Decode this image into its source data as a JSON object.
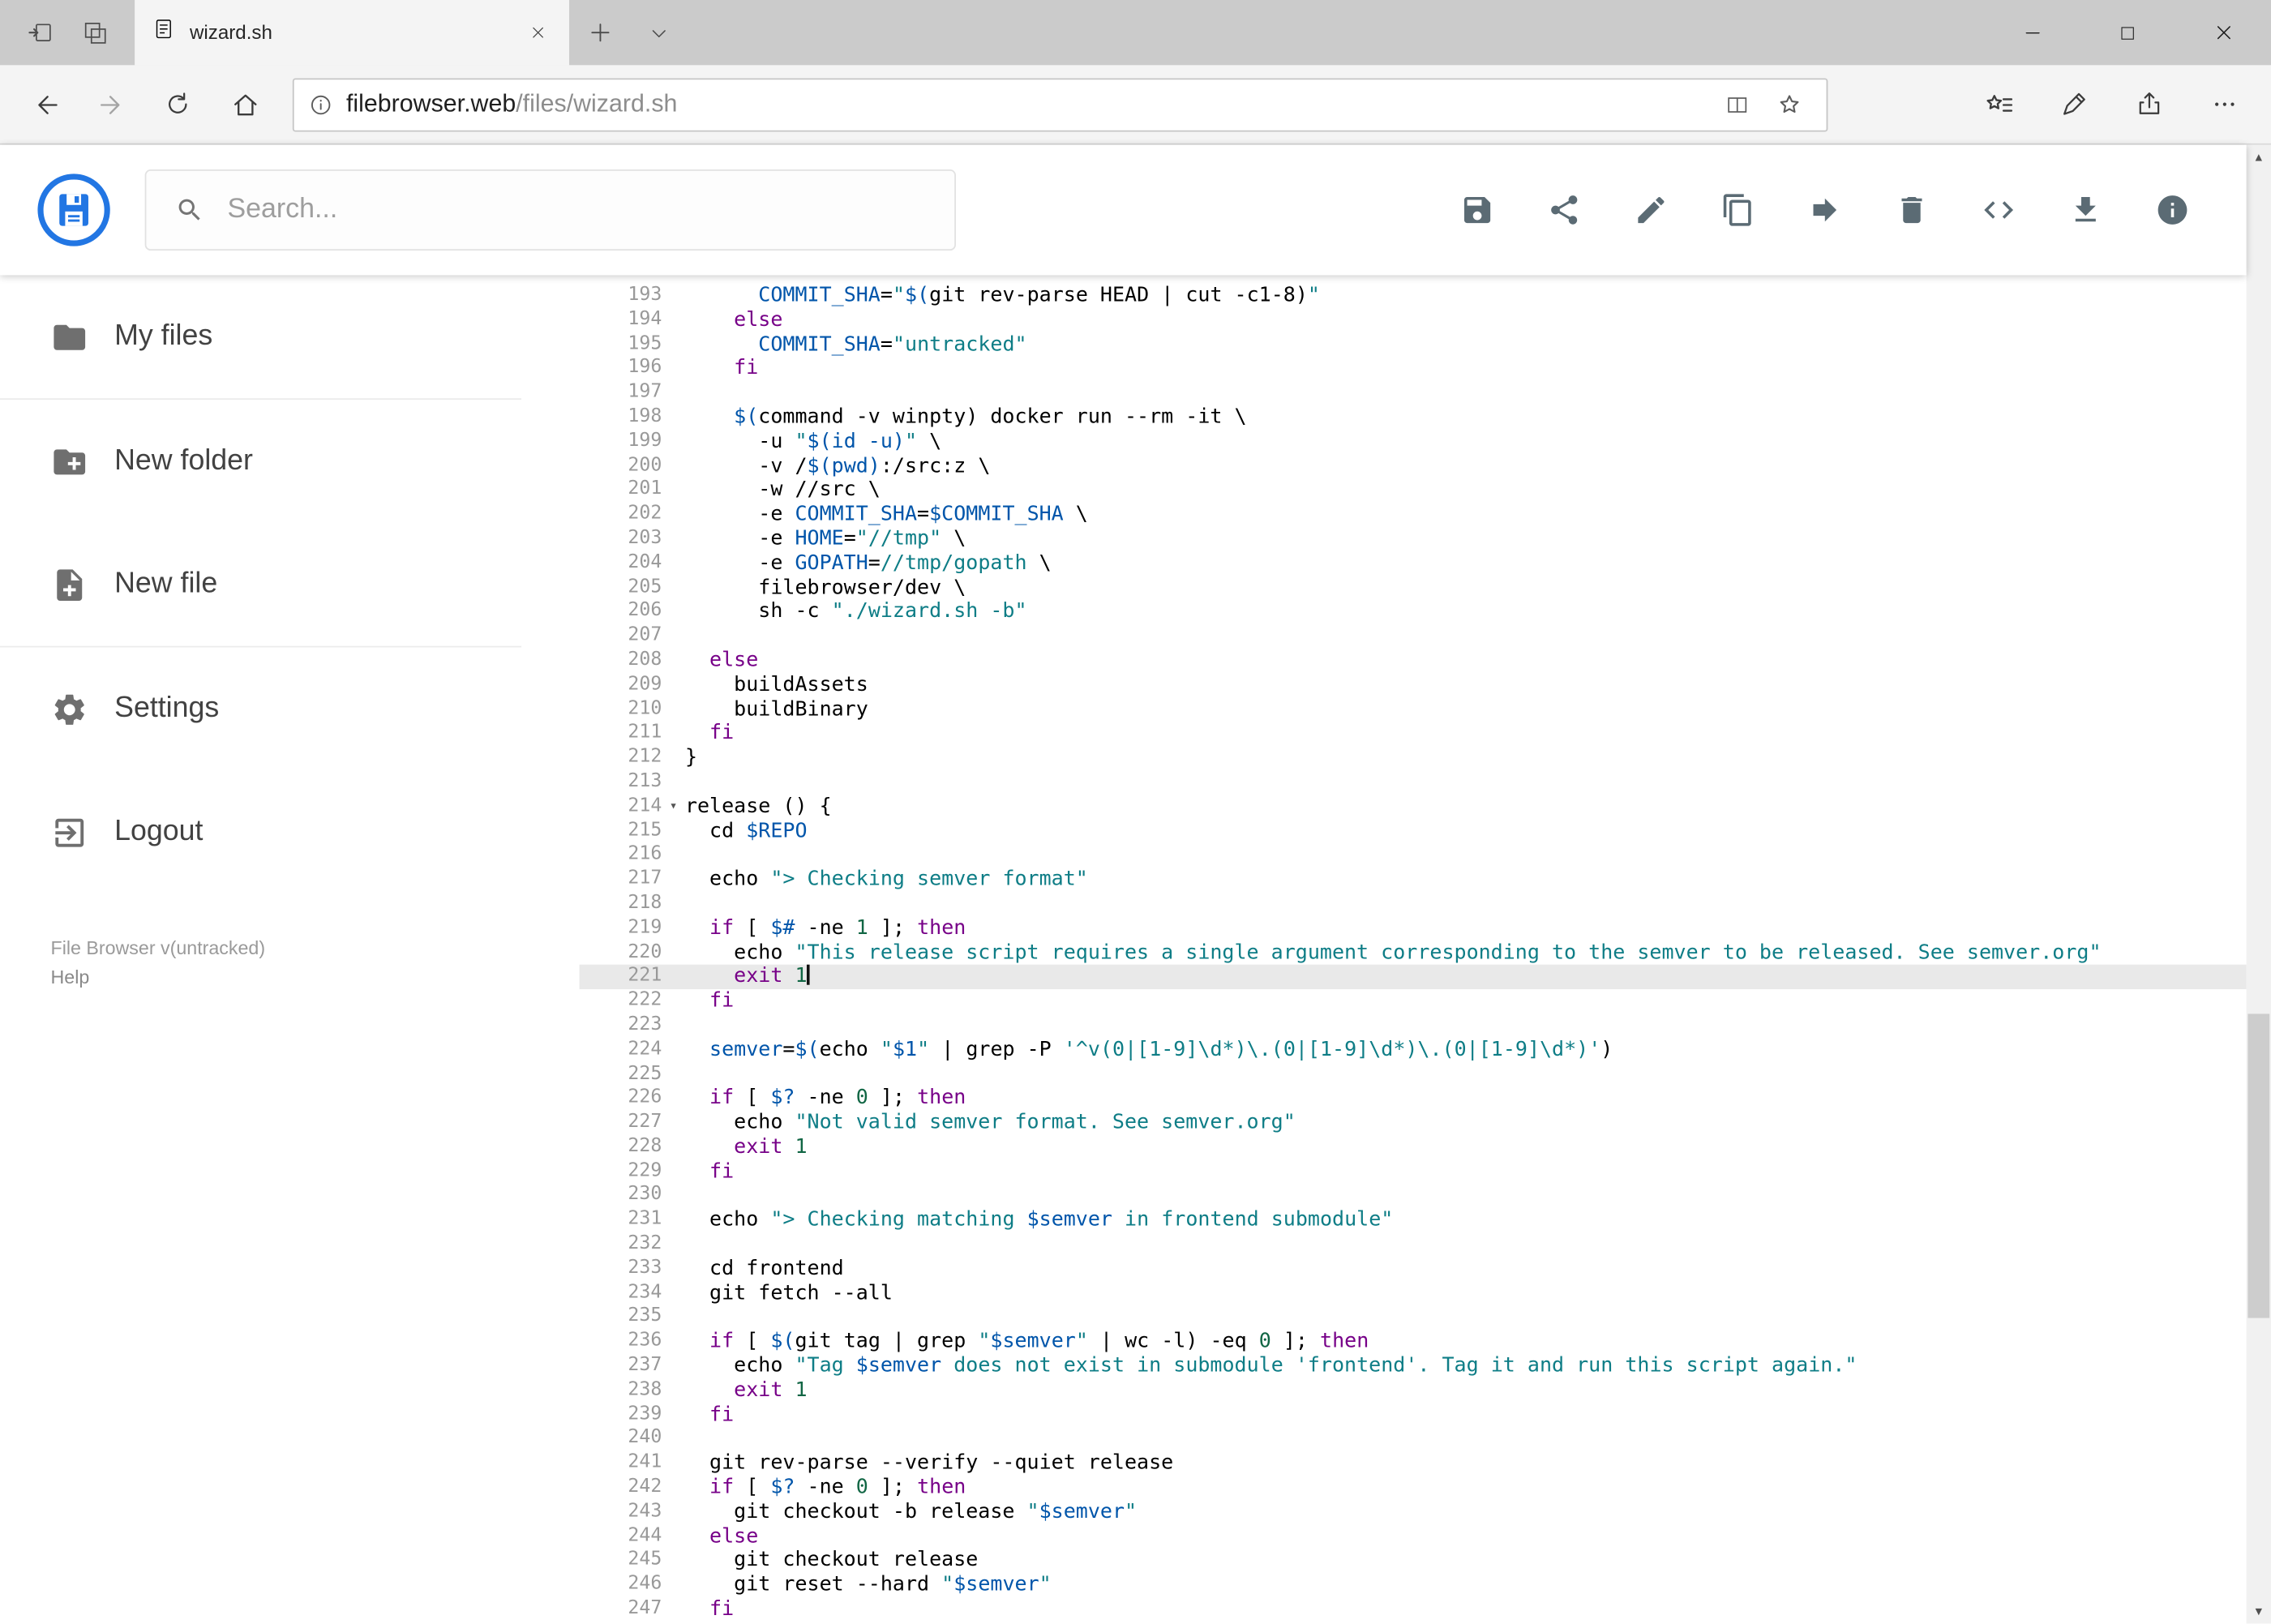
{
  "colors": {
    "accent_blue": "#2276e3",
    "tabbar_bg": "#cbcbcb",
    "chrome_bg": "#f4f4f4",
    "keyword": "#770088",
    "string": "#0e7d86",
    "variable": "#0055aa",
    "number": "#116644",
    "active_line_bg": "#e9e9e9",
    "header_icon": "#5b6b74"
  },
  "browser": {
    "tab_title": "wizard.sh",
    "url_domain": "filebrowser.web",
    "url_path": "/files/wizard.sh",
    "tabbar_icons": [
      "set-tabs-aside",
      "tabs-you-set-aside",
      "new-tab",
      "tab-preview-chevron"
    ],
    "nav_icons": [
      "back",
      "forward",
      "refresh",
      "home"
    ],
    "addressbar_icons": [
      "site-info",
      "reading-view",
      "favorite-star"
    ],
    "navbar_right_icons": [
      "hub",
      "web-note",
      "share",
      "more"
    ],
    "window_controls": [
      "minimize",
      "maximize",
      "close"
    ]
  },
  "header": {
    "search_placeholder": "Search...",
    "toolbar_icons": [
      "save",
      "share",
      "rename",
      "copy",
      "move",
      "delete",
      "source-code",
      "download",
      "info"
    ]
  },
  "sidebar": {
    "items": [
      {
        "label": "My files",
        "icon": "folder"
      },
      {
        "label": "New folder",
        "icon": "create-new-folder"
      },
      {
        "label": "New file",
        "icon": "new-file"
      },
      {
        "label": "Settings",
        "icon": "settings"
      },
      {
        "label": "Logout",
        "icon": "logout"
      }
    ],
    "footer_version": "File Browser v(untracked)",
    "footer_help": "Help"
  },
  "editor": {
    "active_line": 221,
    "folded_marker_line": 214,
    "first_line": 193,
    "last_line": 247,
    "lines": [
      {
        "n": 193,
        "t": [
          [
            "p",
            "      "
          ],
          [
            "v",
            "COMMIT_SHA"
          ],
          [
            "p",
            "="
          ],
          [
            "s",
            "\""
          ],
          [
            "v",
            "$("
          ],
          [
            "p",
            "git rev-parse HEAD | cut -c1-8)"
          ],
          [
            "s",
            "\""
          ]
        ]
      },
      {
        "n": 194,
        "t": [
          [
            "p",
            "    "
          ],
          [
            "k",
            "else"
          ]
        ]
      },
      {
        "n": 195,
        "t": [
          [
            "p",
            "      "
          ],
          [
            "v",
            "COMMIT_SHA"
          ],
          [
            "p",
            "="
          ],
          [
            "s",
            "\"untracked\""
          ]
        ]
      },
      {
        "n": 196,
        "t": [
          [
            "p",
            "    "
          ],
          [
            "k",
            "fi"
          ]
        ]
      },
      {
        "n": 197,
        "t": []
      },
      {
        "n": 198,
        "t": [
          [
            "p",
            "    "
          ],
          [
            "v",
            "$("
          ],
          [
            "p",
            "command -v winpty) docker run --rm -it \\"
          ]
        ]
      },
      {
        "n": 199,
        "t": [
          [
            "p",
            "      -u "
          ],
          [
            "s",
            "\""
          ],
          [
            "v",
            "$(id -u)"
          ],
          [
            "s",
            "\""
          ],
          [
            "p",
            " \\"
          ]
        ]
      },
      {
        "n": 200,
        "t": [
          [
            "p",
            "      -v /"
          ],
          [
            "v",
            "$(pwd)"
          ],
          [
            "p",
            ":/src:z \\"
          ]
        ]
      },
      {
        "n": 201,
        "t": [
          [
            "p",
            "      -w //src \\"
          ]
        ]
      },
      {
        "n": 202,
        "t": [
          [
            "p",
            "      -e "
          ],
          [
            "v",
            "COMMIT_SHA"
          ],
          [
            "p",
            "="
          ],
          [
            "v",
            "$COMMIT_SHA"
          ],
          [
            "p",
            " \\"
          ]
        ]
      },
      {
        "n": 203,
        "t": [
          [
            "p",
            "      -e "
          ],
          [
            "v",
            "HOME"
          ],
          [
            "p",
            "="
          ],
          [
            "s",
            "\"//tmp\""
          ],
          [
            "p",
            " \\"
          ]
        ]
      },
      {
        "n": 204,
        "t": [
          [
            "p",
            "      -e "
          ],
          [
            "v",
            "GOPATH"
          ],
          [
            "p",
            "="
          ],
          [
            "s",
            "//tmp/gopath"
          ],
          [
            "p",
            " \\"
          ]
        ]
      },
      {
        "n": 205,
        "t": [
          [
            "p",
            "      filebrowser/dev \\"
          ]
        ]
      },
      {
        "n": 206,
        "t": [
          [
            "p",
            "      sh -c "
          ],
          [
            "s",
            "\"./wizard.sh -b\""
          ]
        ]
      },
      {
        "n": 207,
        "t": []
      },
      {
        "n": 208,
        "t": [
          [
            "p",
            "  "
          ],
          [
            "k",
            "else"
          ]
        ]
      },
      {
        "n": 209,
        "t": [
          [
            "p",
            "    buildAssets"
          ]
        ]
      },
      {
        "n": 210,
        "t": [
          [
            "p",
            "    buildBinary"
          ]
        ]
      },
      {
        "n": 211,
        "t": [
          [
            "p",
            "  "
          ],
          [
            "k",
            "fi"
          ]
        ]
      },
      {
        "n": 212,
        "t": [
          [
            "p",
            "}"
          ]
        ]
      },
      {
        "n": 213,
        "t": []
      },
      {
        "n": 214,
        "fold": true,
        "t": [
          [
            "p",
            "release () {"
          ]
        ]
      },
      {
        "n": 215,
        "t": [
          [
            "p",
            "  cd "
          ],
          [
            "v",
            "$REPO"
          ]
        ]
      },
      {
        "n": 216,
        "t": []
      },
      {
        "n": 217,
        "t": [
          [
            "p",
            "  echo "
          ],
          [
            "s",
            "\"> Checking semver format\""
          ]
        ]
      },
      {
        "n": 218,
        "t": []
      },
      {
        "n": 219,
        "t": [
          [
            "p",
            "  "
          ],
          [
            "k",
            "if"
          ],
          [
            "p",
            " [ "
          ],
          [
            "v",
            "$#"
          ],
          [
            "p",
            " -ne "
          ],
          [
            "n",
            "1"
          ],
          [
            "p",
            " ]; "
          ],
          [
            "k",
            "then"
          ]
        ]
      },
      {
        "n": 220,
        "t": [
          [
            "p",
            "    echo "
          ],
          [
            "s",
            "\"This release script requires a single argument corresponding to the semver to be released. See semver.org\""
          ]
        ]
      },
      {
        "n": 221,
        "t": [
          [
            "p",
            "    "
          ],
          [
            "k",
            "exit"
          ],
          [
            "p",
            " "
          ],
          [
            "n",
            "1"
          ]
        ]
      },
      {
        "n": 222,
        "t": [
          [
            "p",
            "  "
          ],
          [
            "k",
            "fi"
          ]
        ]
      },
      {
        "n": 223,
        "t": []
      },
      {
        "n": 224,
        "t": [
          [
            "p",
            "  "
          ],
          [
            "v",
            "semver"
          ],
          [
            "p",
            "="
          ],
          [
            "v",
            "$("
          ],
          [
            "p",
            "echo "
          ],
          [
            "s",
            "\""
          ],
          [
            "v",
            "$1"
          ],
          [
            "s",
            "\""
          ],
          [
            "p",
            " | grep -P "
          ],
          [
            "s",
            "'^v(0|[1-9]\\d*)\\.(0|[1-9]\\d*)\\.(0|[1-9]\\d*)'"
          ],
          [
            "p",
            ")"
          ]
        ]
      },
      {
        "n": 225,
        "t": []
      },
      {
        "n": 226,
        "t": [
          [
            "p",
            "  "
          ],
          [
            "k",
            "if"
          ],
          [
            "p",
            " [ "
          ],
          [
            "v",
            "$?"
          ],
          [
            "p",
            " -ne "
          ],
          [
            "n",
            "0"
          ],
          [
            "p",
            " ]; "
          ],
          [
            "k",
            "then"
          ]
        ]
      },
      {
        "n": 227,
        "t": [
          [
            "p",
            "    echo "
          ],
          [
            "s",
            "\"Not valid semver format. See semver.org\""
          ]
        ]
      },
      {
        "n": 228,
        "t": [
          [
            "p",
            "    "
          ],
          [
            "k",
            "exit"
          ],
          [
            "p",
            " "
          ],
          [
            "n",
            "1"
          ]
        ]
      },
      {
        "n": 229,
        "t": [
          [
            "p",
            "  "
          ],
          [
            "k",
            "fi"
          ]
        ]
      },
      {
        "n": 230,
        "t": []
      },
      {
        "n": 231,
        "t": [
          [
            "p",
            "  echo "
          ],
          [
            "s",
            "\"> Checking matching "
          ],
          [
            "v",
            "$semver"
          ],
          [
            "s",
            " in frontend submodule\""
          ]
        ]
      },
      {
        "n": 232,
        "t": []
      },
      {
        "n": 233,
        "t": [
          [
            "p",
            "  cd frontend"
          ]
        ]
      },
      {
        "n": 234,
        "t": [
          [
            "p",
            "  git fetch --all"
          ]
        ]
      },
      {
        "n": 235,
        "t": []
      },
      {
        "n": 236,
        "t": [
          [
            "p",
            "  "
          ],
          [
            "k",
            "if"
          ],
          [
            "p",
            " [ "
          ],
          [
            "v",
            "$("
          ],
          [
            "p",
            "git tag | grep "
          ],
          [
            "s",
            "\""
          ],
          [
            "v",
            "$semver"
          ],
          [
            "s",
            "\""
          ],
          [
            "p",
            " | wc -l) -eq "
          ],
          [
            "n",
            "0"
          ],
          [
            "p",
            " ]; "
          ],
          [
            "k",
            "then"
          ]
        ]
      },
      {
        "n": 237,
        "t": [
          [
            "p",
            "    echo "
          ],
          [
            "s",
            "\"Tag "
          ],
          [
            "v",
            "$semver"
          ],
          [
            "s",
            " does not exist in submodule 'frontend'. Tag it and run this script again.\""
          ]
        ]
      },
      {
        "n": 238,
        "t": [
          [
            "p",
            "    "
          ],
          [
            "k",
            "exit"
          ],
          [
            "p",
            " "
          ],
          [
            "n",
            "1"
          ]
        ]
      },
      {
        "n": 239,
        "t": [
          [
            "p",
            "  "
          ],
          [
            "k",
            "fi"
          ]
        ]
      },
      {
        "n": 240,
        "t": []
      },
      {
        "n": 241,
        "t": [
          [
            "p",
            "  git rev-parse --verify --quiet release"
          ]
        ]
      },
      {
        "n": 242,
        "t": [
          [
            "p",
            "  "
          ],
          [
            "k",
            "if"
          ],
          [
            "p",
            " [ "
          ],
          [
            "v",
            "$?"
          ],
          [
            "p",
            " -ne "
          ],
          [
            "n",
            "0"
          ],
          [
            "p",
            " ]; "
          ],
          [
            "k",
            "then"
          ]
        ]
      },
      {
        "n": 243,
        "t": [
          [
            "p",
            "    git checkout -b release "
          ],
          [
            "s",
            "\""
          ],
          [
            "v",
            "$semver"
          ],
          [
            "s",
            "\""
          ]
        ]
      },
      {
        "n": 244,
        "t": [
          [
            "p",
            "  "
          ],
          [
            "k",
            "else"
          ]
        ]
      },
      {
        "n": 245,
        "t": [
          [
            "p",
            "    git checkout release"
          ]
        ]
      },
      {
        "n": 246,
        "t": [
          [
            "p",
            "    git reset --hard "
          ],
          [
            "s",
            "\""
          ],
          [
            "v",
            "$semver"
          ],
          [
            "s",
            "\""
          ]
        ]
      },
      {
        "n": 247,
        "t": [
          [
            "p",
            "  "
          ],
          [
            "k",
            "fi"
          ]
        ]
      }
    ]
  }
}
